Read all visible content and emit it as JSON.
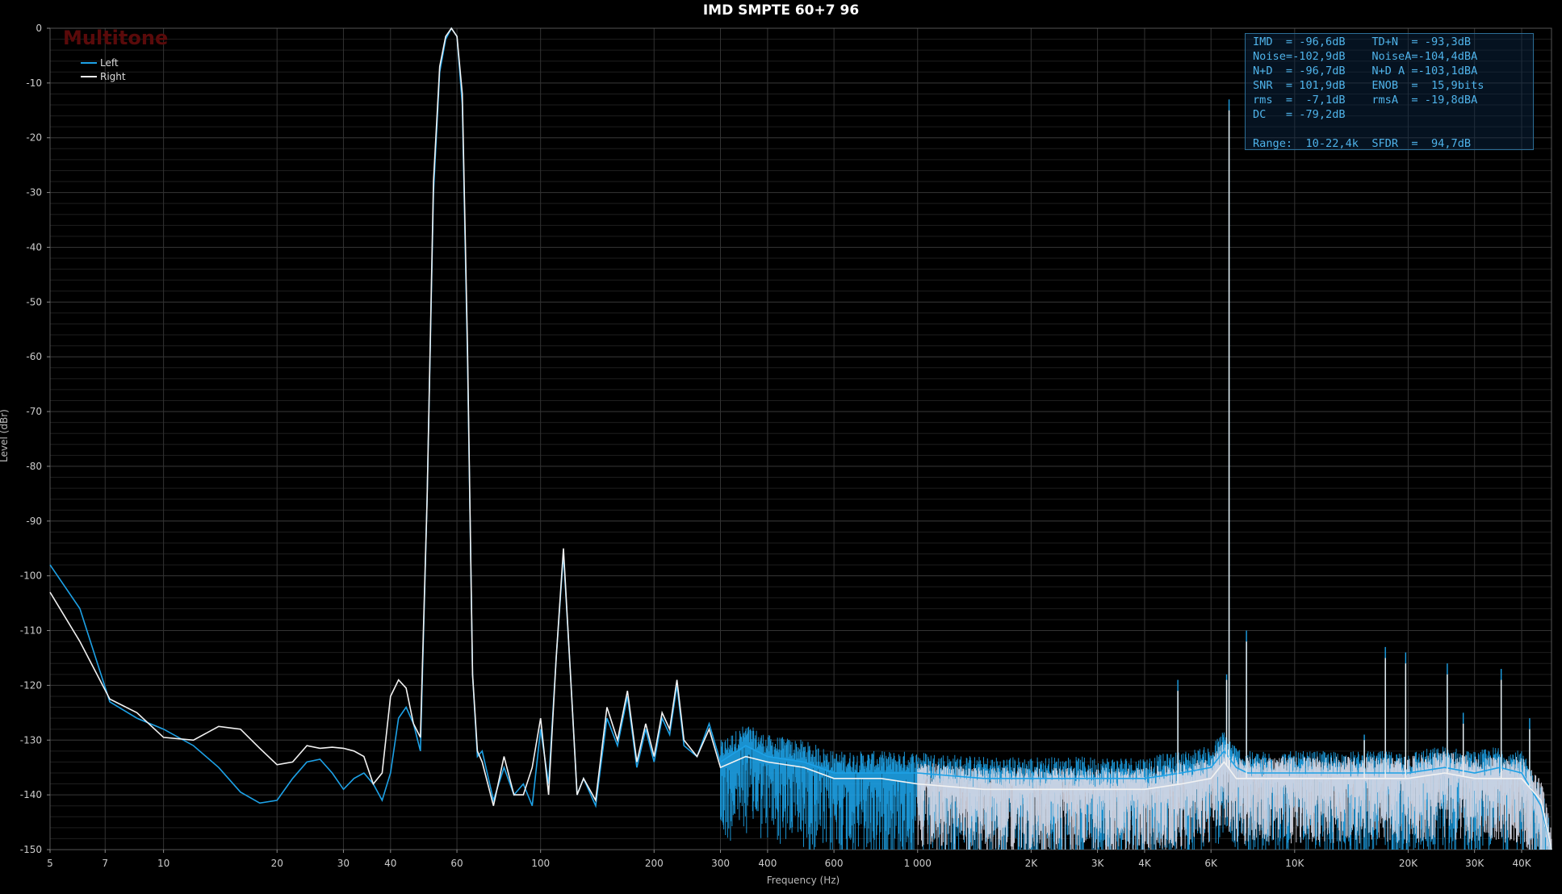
{
  "title": "IMD SMPTE 60+7 96",
  "brand": "Multitone",
  "stats": [
    "IMD  = -96,6dB    TD+N  = -93,3dB",
    "Noise=-102,9dB    NoiseA=-104,4dBA",
    "N+D  = -96,7dB    N+D A =-103,1dBA",
    "SNR  = 101,9dB    ENOB  =  15,9bits",
    "rms  =  -7,1dB    rmsA  = -19,8dBA",
    "DC   = -79,2dB",
    "",
    "Range:  10-22,4k  SFDR  =  94,7dB"
  ],
  "colors": {
    "left": "#1da1e6",
    "right": "#f2f2f2",
    "fill_right": "#d8d8e4",
    "grid": "#3a3a3a"
  },
  "chart_data": {
    "type": "line",
    "title": "IMD SMPTE 60+7 96",
    "xlabel": "Frequency (Hz)",
    "ylabel": "Level (dBr)",
    "xscale": "log",
    "xlim": [
      5,
      48000
    ],
    "ylim": [
      -150,
      0
    ],
    "legend_position": "top-left",
    "grid": true,
    "x_ticks": [
      5,
      7,
      10,
      20,
      30,
      40,
      60,
      100,
      200,
      300,
      400,
      600,
      1000,
      2000,
      3000,
      4000,
      6000,
      10000,
      20000,
      30000,
      40000
    ],
    "x_tick_labels": [
      "5",
      "7",
      "10",
      "20",
      "30",
      "40",
      "60",
      "100",
      "200",
      "300",
      "400",
      "600",
      "1 000",
      "2K",
      "3K",
      "4K",
      "6K",
      "10K",
      "20K",
      "30K",
      "40K"
    ],
    "y_ticks": [
      0,
      -10,
      -20,
      -30,
      -40,
      -50,
      -60,
      -70,
      -80,
      -90,
      -100,
      -110,
      -120,
      -130,
      -140,
      -150
    ],
    "series": [
      {
        "name": "Left",
        "x": [
          5,
          6,
          7.2,
          8.5,
          10,
          12,
          14,
          16,
          18,
          20,
          22,
          24,
          26,
          28,
          30,
          32,
          34,
          36,
          38,
          40,
          42,
          44,
          46,
          48,
          50,
          52,
          54,
          56,
          58,
          60,
          62,
          64,
          66,
          68,
          70,
          75,
          80,
          85,
          90,
          95,
          100,
          105,
          110,
          115,
          120,
          125,
          130,
          140,
          150,
          160,
          170,
          180,
          190,
          200,
          210,
          220,
          230,
          240,
          260,
          280,
          300,
          350,
          400,
          500,
          600,
          800,
          1000,
          1500,
          2000,
          3000,
          4000,
          5000,
          6000,
          6500,
          7000,
          7500,
          8000,
          10000,
          14000,
          18000,
          20000,
          25000,
          30000,
          35000,
          40000,
          45000,
          48000
        ],
        "y": [
          -98,
          -106,
          -123,
          -126,
          -128,
          -131,
          -135,
          -139.5,
          -141.5,
          -141,
          -137,
          -134,
          -133.5,
          -136,
          -139,
          -137,
          -136,
          -138,
          -141,
          -136,
          -126,
          -124,
          -127,
          -132,
          -86,
          -30,
          -8,
          -2,
          0,
          -1.5,
          -14,
          -60,
          -118,
          -133,
          -132,
          -141,
          -135,
          -140,
          -138,
          -142,
          -128,
          -138,
          -115,
          -96,
          -118,
          -140,
          -137,
          -142,
          -126,
          -131,
          -122,
          -135,
          -128,
          -134,
          -126,
          -129,
          -120,
          -131,
          -133,
          -127,
          -134,
          -131,
          -133,
          -134,
          -136,
          -136,
          -136,
          -137,
          -137,
          -137,
          -137,
          -136,
          -135,
          -132,
          -135,
          -136,
          -136,
          -136,
          -136,
          -136,
          -136,
          -135,
          -136,
          -135,
          -136,
          -142,
          -150
        ],
        "spikes": [
          [
            4900,
            -119
          ],
          [
            6600,
            -118
          ],
          [
            6700,
            -13
          ],
          [
            7450,
            -110
          ],
          [
            15300,
            -129
          ],
          [
            17400,
            -113
          ],
          [
            19700,
            -114
          ],
          [
            25400,
            -116
          ],
          [
            28000,
            -125
          ],
          [
            35300,
            -117
          ],
          [
            42000,
            -126
          ]
        ]
      },
      {
        "name": "Right",
        "x": [
          5,
          6,
          7.2,
          8.5,
          10,
          12,
          14,
          16,
          18,
          20,
          22,
          24,
          26,
          28,
          30,
          32,
          34,
          36,
          38,
          40,
          42,
          44,
          46,
          48,
          50,
          52,
          54,
          56,
          58,
          60,
          62,
          64,
          66,
          68,
          70,
          75,
          80,
          85,
          90,
          95,
          100,
          105,
          110,
          115,
          120,
          125,
          130,
          140,
          150,
          160,
          170,
          180,
          190,
          200,
          210,
          220,
          230,
          240,
          260,
          280,
          300,
          350,
          400,
          500,
          600,
          800,
          1000,
          1500,
          2000,
          3000,
          4000,
          5000,
          6000,
          6500,
          7000,
          7500,
          8000,
          10000,
          14000,
          18000,
          20000,
          25000,
          30000,
          35000,
          40000,
          45000,
          48000
        ],
        "y": [
          -103,
          -112,
          -122.5,
          -125,
          -129.5,
          -130,
          -127.5,
          -128,
          -131.5,
          -134.5,
          -134,
          -131,
          -131.5,
          -131.3,
          -131.5,
          -132,
          -133,
          -138,
          -136,
          -122,
          -119,
          -120.5,
          -127,
          -129.5,
          -86,
          -28,
          -7,
          -1.5,
          0,
          -1.5,
          -12,
          -58,
          -118,
          -132,
          -134,
          -142,
          -133,
          -140,
          -140,
          -135,
          -126,
          -140,
          -115,
          -95,
          -118,
          -140,
          -137,
          -141,
          -124,
          -130,
          -121,
          -134,
          -127,
          -133,
          -125,
          -128,
          -119,
          -130,
          -133,
          -128,
          -135,
          -133,
          -134,
          -135,
          -137,
          -137,
          -138,
          -139,
          -139,
          -139,
          -139,
          -138,
          -137,
          -134,
          -137,
          -137,
          -137,
          -137,
          -137,
          -137,
          -137,
          -136,
          -137,
          -137,
          -137,
          -141,
          -150
        ],
        "spikes": [
          [
            4900,
            -121
          ],
          [
            6600,
            -119
          ],
          [
            6700,
            -15
          ],
          [
            7450,
            -112
          ],
          [
            15300,
            -130
          ],
          [
            17400,
            -115
          ],
          [
            19700,
            -116
          ],
          [
            25400,
            -118
          ],
          [
            28000,
            -127
          ],
          [
            35300,
            -119
          ],
          [
            42000,
            -128
          ]
        ]
      }
    ]
  }
}
